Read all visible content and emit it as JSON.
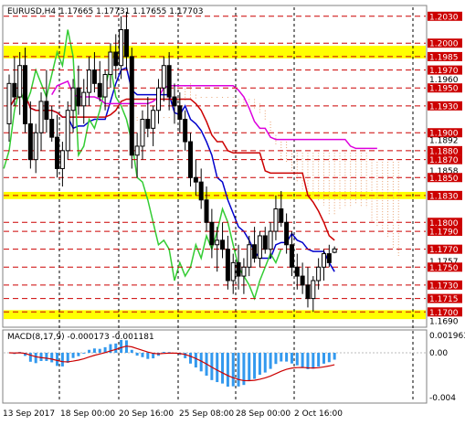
{
  "header": {
    "symbol_timeframe": "EURUSD,H4",
    "prices": "1.17665 1.17731 1.17655 1.17703"
  },
  "price_axis": {
    "levels": [
      {
        "label": "1.2030",
        "value": 1.203,
        "boxed": true
      },
      {
        "label": "1.2000",
        "value": 1.2,
        "boxed": true
      },
      {
        "label": "1.1985",
        "value": 1.1985,
        "boxed": true
      },
      {
        "label": "1.1970",
        "value": 1.197,
        "boxed": true
      },
      {
        "label": "1.1960",
        "value": 1.196,
        "boxed": false
      },
      {
        "label": "1.1950",
        "value": 1.195,
        "boxed": true
      },
      {
        "label": "1.1930",
        "value": 1.193,
        "boxed": true
      },
      {
        "label": "1.1900",
        "value": 1.19,
        "boxed": true
      },
      {
        "label": "1.1892",
        "value": 1.1892,
        "boxed": false
      },
      {
        "label": "1.1880",
        "value": 1.188,
        "boxed": true
      },
      {
        "label": "1.1870",
        "value": 1.187,
        "boxed": true
      },
      {
        "label": "1.1858",
        "value": 1.1858,
        "boxed": false
      },
      {
        "label": "1.1850",
        "value": 1.185,
        "boxed": true
      },
      {
        "label": "1.1830",
        "value": 1.183,
        "boxed": true
      },
      {
        "label": "1.1800",
        "value": 1.18,
        "boxed": true
      },
      {
        "label": "1.1790",
        "value": 1.179,
        "boxed": true
      },
      {
        "label": "1.1770",
        "value": 1.177,
        "boxed": true
      },
      {
        "label": "1.1757",
        "value": 1.1757,
        "boxed": false
      },
      {
        "label": "1.1750",
        "value": 1.175,
        "boxed": true
      },
      {
        "label": "1.1730",
        "value": 1.173,
        "boxed": true
      },
      {
        "label": "1.1715",
        "value": 1.1715,
        "boxed": true
      },
      {
        "label": "1.1700",
        "value": 1.17,
        "boxed": true
      },
      {
        "label": "1.1690",
        "value": 1.169,
        "boxed": false
      }
    ],
    "yellow_bands": [
      [
        1.1983,
        1.1997
      ],
      [
        1.1826,
        1.1834
      ],
      [
        1.1692,
        1.1702
      ]
    ]
  },
  "macd": {
    "label": "MACD(8,17,9) -0.000173 -0.001181",
    "axis_labels": [
      "0.001963",
      "0.00",
      "-0.004"
    ]
  },
  "time_axis": [
    "13 Sep 2017",
    "18 Sep 00:00",
    "20 Sep 16:00",
    "25 Sep 08:00",
    "28 Sep 00:00",
    "2 Oct 16:00"
  ],
  "colors": {
    "background": "#ffffff",
    "level_line": "#cc0000",
    "band": "#ffff00",
    "candle": "#000000",
    "tenkan": "#0000cc",
    "kijun": "#cc0000",
    "chikou": "#33cc33",
    "magenta_line": "#dd00dd",
    "cloud_dots": "#e8a070",
    "histogram": "#3399ee",
    "signal": "#cc0000"
  },
  "chart_data": {
    "type": "candlestick",
    "symbol": "EURUSD",
    "timeframe": "H4",
    "ohlc_last": {
      "open": 1.17665,
      "high": 1.17731,
      "low": 1.17655,
      "close": 1.17703
    },
    "ylim": [
      1.1685,
      1.204
    ],
    "candles": [
      [
        1.191,
        1.1965,
        1.189,
        1.1955
      ],
      [
        1.1955,
        1.1985,
        1.193,
        1.194
      ],
      [
        1.194,
        1.199,
        1.192,
        1.1975
      ],
      [
        1.1975,
        1.1995,
        1.19,
        1.191
      ],
      [
        1.191,
        1.1935,
        1.186,
        1.187
      ],
      [
        1.187,
        1.191,
        1.1855,
        1.19
      ],
      [
        1.19,
        1.1945,
        1.188,
        1.1935
      ],
      [
        1.1935,
        1.197,
        1.19,
        1.1915
      ],
      [
        1.1915,
        1.193,
        1.189,
        1.1895
      ],
      [
        1.1895,
        1.192,
        1.185,
        1.186
      ],
      [
        1.186,
        1.189,
        1.184,
        1.188
      ],
      [
        1.188,
        1.1935,
        1.187,
        1.1925
      ],
      [
        1.1925,
        1.196,
        1.19,
        1.195
      ],
      [
        1.195,
        1.1975,
        1.192,
        1.193
      ],
      [
        1.193,
        1.196,
        1.191,
        1.1945
      ],
      [
        1.1945,
        1.1985,
        1.193,
        1.197
      ],
      [
        1.197,
        1.199,
        1.1945,
        1.1955
      ],
      [
        1.1955,
        1.198,
        1.1935,
        1.194
      ],
      [
        1.194,
        1.197,
        1.1925,
        1.1965
      ],
      [
        1.1965,
        1.2,
        1.195,
        1.199
      ],
      [
        1.199,
        1.201,
        1.196,
        1.1975
      ],
      [
        1.1975,
        1.203,
        1.196,
        1.2015
      ],
      [
        1.2015,
        1.2035,
        1.197,
        1.1985
      ],
      [
        1.1985,
        1.1995,
        1.186,
        1.1875
      ],
      [
        1.1875,
        1.19,
        1.185,
        1.1885
      ],
      [
        1.1885,
        1.1925,
        1.187,
        1.1915
      ],
      [
        1.1915,
        1.194,
        1.1895,
        1.1905
      ],
      [
        1.1905,
        1.193,
        1.1885,
        1.1925
      ],
      [
        1.1925,
        1.196,
        1.191,
        1.195
      ],
      [
        1.195,
        1.1985,
        1.1935,
        1.1975
      ],
      [
        1.1975,
        1.199,
        1.1925,
        1.194
      ],
      [
        1.194,
        1.1955,
        1.191,
        1.193
      ],
      [
        1.193,
        1.1945,
        1.19,
        1.1915
      ],
      [
        1.1915,
        1.1925,
        1.188,
        1.189
      ],
      [
        1.189,
        1.19,
        1.184,
        1.185
      ],
      [
        1.185,
        1.187,
        1.183,
        1.1845
      ],
      [
        1.1845,
        1.186,
        1.1815,
        1.1825
      ],
      [
        1.1825,
        1.184,
        1.179,
        1.18
      ],
      [
        1.18,
        1.1815,
        1.176,
        1.1775
      ],
      [
        1.1775,
        1.1795,
        1.1745,
        1.178
      ],
      [
        1.178,
        1.18,
        1.176,
        1.177
      ],
      [
        1.177,
        1.1785,
        1.1725,
        1.1735
      ],
      [
        1.1735,
        1.1765,
        1.172,
        1.1755
      ],
      [
        1.1755,
        1.1775,
        1.1725,
        1.174
      ],
      [
        1.174,
        1.176,
        1.172,
        1.175
      ],
      [
        1.175,
        1.1785,
        1.174,
        1.1775
      ],
      [
        1.1775,
        1.1795,
        1.1755,
        1.176
      ],
      [
        1.176,
        1.179,
        1.175,
        1.1785
      ],
      [
        1.1785,
        1.1795,
        1.1765,
        1.177
      ],
      [
        1.177,
        1.18,
        1.176,
        1.179
      ],
      [
        1.179,
        1.183,
        1.178,
        1.1815
      ],
      [
        1.1815,
        1.1835,
        1.1795,
        1.18
      ],
      [
        1.18,
        1.181,
        1.1765,
        1.1775
      ],
      [
        1.1775,
        1.179,
        1.174,
        1.175
      ],
      [
        1.175,
        1.1765,
        1.1725,
        1.174
      ],
      [
        1.174,
        1.1755,
        1.172,
        1.173
      ],
      [
        1.173,
        1.175,
        1.1705,
        1.1715
      ],
      [
        1.1715,
        1.174,
        1.17,
        1.1735
      ],
      [
        1.1735,
        1.176,
        1.1725,
        1.175
      ],
      [
        1.175,
        1.177,
        1.1735,
        1.1765
      ],
      [
        1.1765,
        1.1775,
        1.175,
        1.1755
      ],
      [
        1.17665,
        1.17731,
        1.17655,
        1.17703
      ]
    ]
  }
}
